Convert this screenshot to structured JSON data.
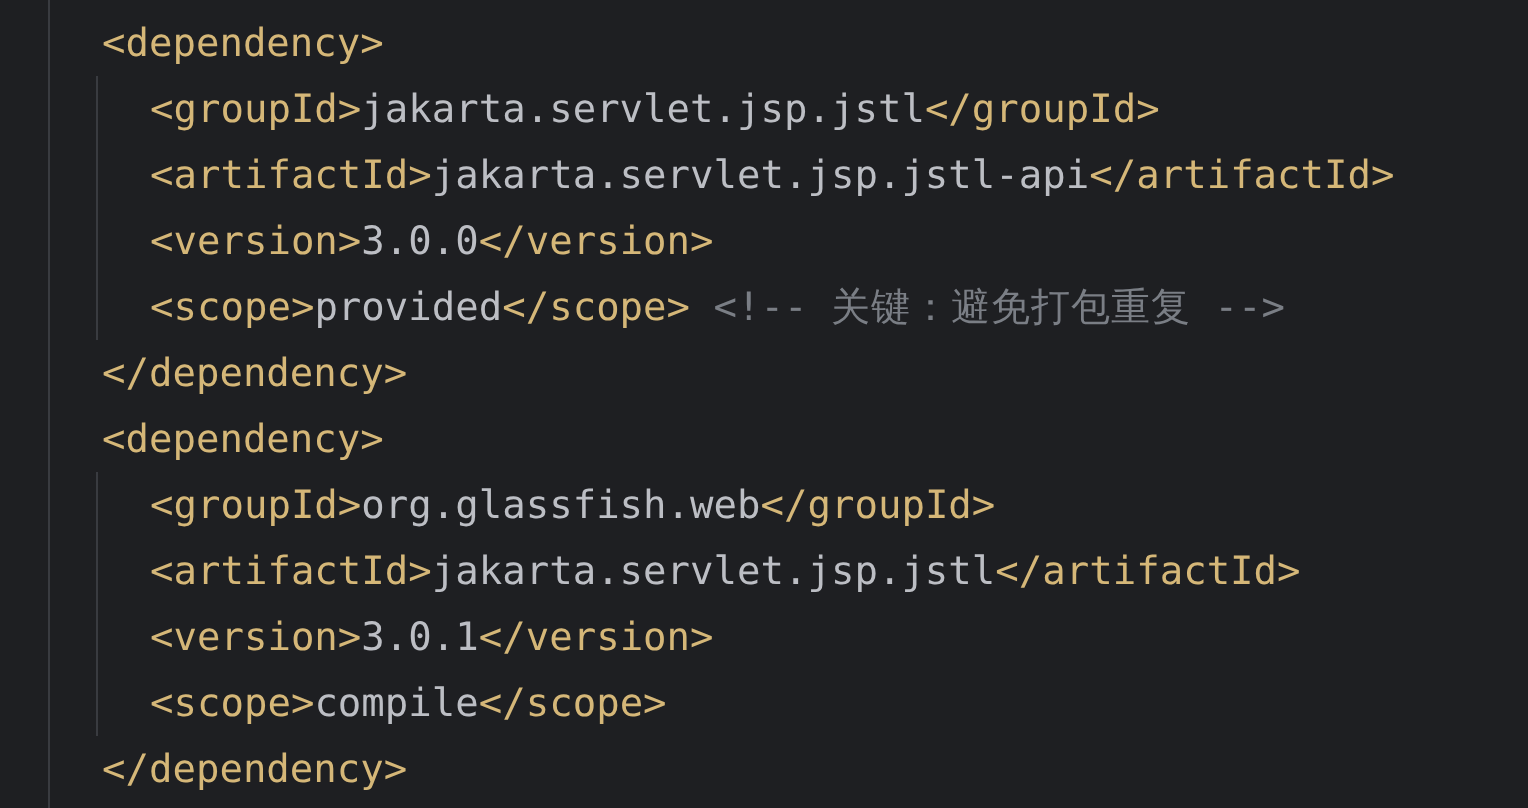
{
  "blocks": [
    {
      "open": "<dependency>",
      "close": "</dependency>",
      "lines": [
        {
          "tokens": [
            {
              "kind": "tag",
              "text": "<groupId>"
            },
            {
              "kind": "value",
              "text": "jakarta.servlet.jsp.jstl"
            },
            {
              "kind": "tag",
              "text": "</groupId>"
            }
          ]
        },
        {
          "tokens": [
            {
              "kind": "tag",
              "text": "<artifactId>"
            },
            {
              "kind": "value",
              "text": "jakarta.servlet.jsp.jstl-api"
            },
            {
              "kind": "tag",
              "text": "</artifactId>"
            }
          ]
        },
        {
          "tokens": [
            {
              "kind": "tag",
              "text": "<version>"
            },
            {
              "kind": "value",
              "text": "3.0.0"
            },
            {
              "kind": "tag",
              "text": "</version>"
            }
          ]
        },
        {
          "tokens": [
            {
              "kind": "tag",
              "text": "<scope>"
            },
            {
              "kind": "value",
              "text": "provided"
            },
            {
              "kind": "tag",
              "text": "</scope>"
            },
            {
              "kind": "comment",
              "text": " <!-- 关键：避免打包重复 -->"
            }
          ]
        }
      ]
    },
    {
      "open": "<dependency>",
      "close": "</dependency>",
      "lines": [
        {
          "tokens": [
            {
              "kind": "tag",
              "text": "<groupId>"
            },
            {
              "kind": "value",
              "text": "org.glassfish.web"
            },
            {
              "kind": "tag",
              "text": "</groupId>"
            }
          ]
        },
        {
          "tokens": [
            {
              "kind": "tag",
              "text": "<artifactId>"
            },
            {
              "kind": "value",
              "text": "jakarta.servlet.jsp.jstl"
            },
            {
              "kind": "tag",
              "text": "</artifactId>"
            }
          ]
        },
        {
          "tokens": [
            {
              "kind": "tag",
              "text": "<version>"
            },
            {
              "kind": "value",
              "text": "3.0.1"
            },
            {
              "kind": "tag",
              "text": "</version>"
            }
          ]
        },
        {
          "tokens": [
            {
              "kind": "tag",
              "text": "<scope>"
            },
            {
              "kind": "value",
              "text": "compile"
            },
            {
              "kind": "tag",
              "text": "</scope>"
            }
          ]
        }
      ]
    }
  ]
}
